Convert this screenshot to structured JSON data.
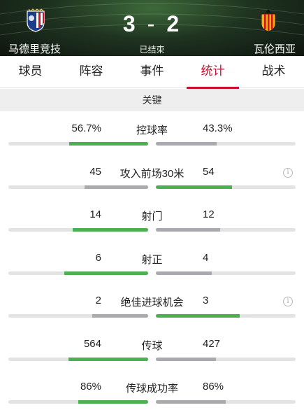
{
  "match": {
    "home_team": "马德里竞技",
    "away_team": "瓦伦西亚",
    "home_score": "3",
    "separator": "-",
    "away_score": "2",
    "status": "已结束"
  },
  "tabs": [
    {
      "label": "球员",
      "active": false
    },
    {
      "label": "阵容",
      "active": false
    },
    {
      "label": "事件",
      "active": false
    },
    {
      "label": "统计",
      "active": true
    },
    {
      "label": "战术",
      "active": false
    }
  ],
  "section_title": "关键",
  "colors": {
    "accent": "#c8102e",
    "bar_leading": "#4caf50",
    "bar_trailing": "#a9a9ae",
    "bar_track": "#e3e3e3"
  },
  "stats": [
    {
      "label": "控球率",
      "home": "56.7%",
      "away": "43.3%",
      "home_value": 56.7,
      "away_value": 43.3,
      "info": false
    },
    {
      "label": "攻入前场30米",
      "home": "45",
      "away": "54",
      "home_value": 45,
      "away_value": 54,
      "info": true
    },
    {
      "label": "射门",
      "home": "14",
      "away": "12",
      "home_value": 14,
      "away_value": 12,
      "info": false
    },
    {
      "label": "射正",
      "home": "6",
      "away": "4",
      "home_value": 6,
      "away_value": 4,
      "info": false
    },
    {
      "label": "绝佳进球机会",
      "home": "2",
      "away": "3",
      "home_value": 2,
      "away_value": 3,
      "info": true
    },
    {
      "label": "传球",
      "home": "564",
      "away": "427",
      "home_value": 564,
      "away_value": 427,
      "info": false
    },
    {
      "label": "传球成功率",
      "home": "86%",
      "away": "86%",
      "home_value": 86,
      "away_value": 86,
      "info": false
    }
  ],
  "icons": {
    "home_crest": "atletico-madrid-crest-icon",
    "away_crest": "valencia-crest-icon",
    "info": "info-icon"
  }
}
